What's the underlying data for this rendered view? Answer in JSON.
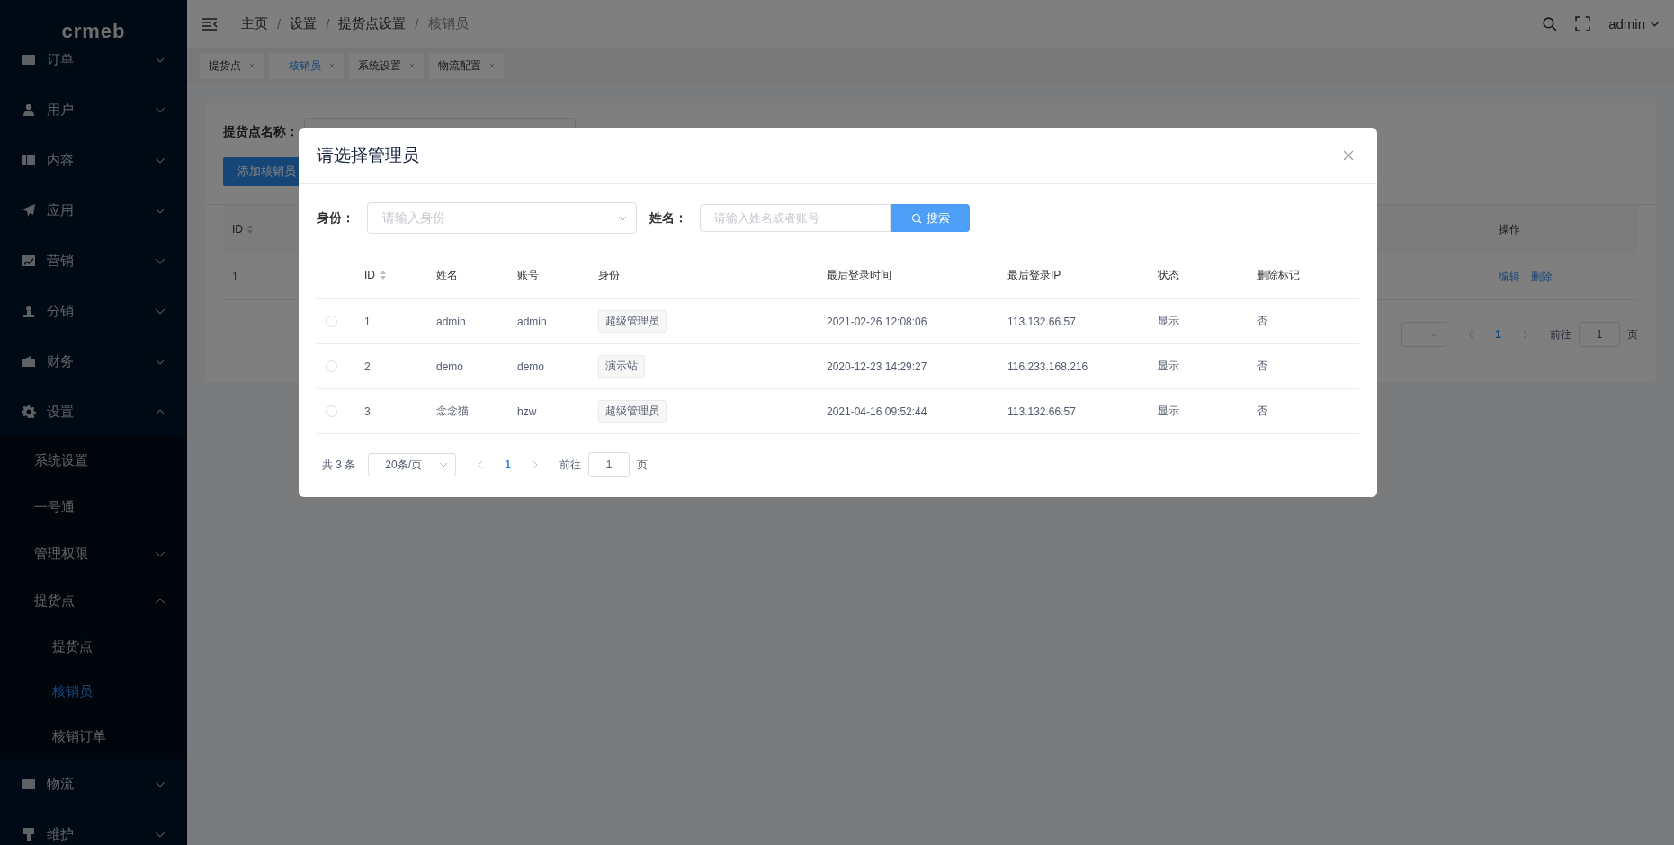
{
  "sidebar": {
    "logo": "crmeb",
    "items": [
      {
        "label": "订单",
        "expanded": false
      },
      {
        "label": "用户",
        "expanded": false
      },
      {
        "label": "内容",
        "expanded": false
      },
      {
        "label": "应用",
        "expanded": false
      },
      {
        "label": "营销",
        "expanded": false
      },
      {
        "label": "分销",
        "expanded": false
      },
      {
        "label": "财务",
        "expanded": false
      },
      {
        "label": "设置",
        "expanded": true,
        "children": [
          {
            "label": "系统设置"
          },
          {
            "label": "一号通"
          },
          {
            "label": "管理权限",
            "expanded": false
          },
          {
            "label": "提货点",
            "expanded": true,
            "children": [
              {
                "label": "提货点",
                "selected": false
              },
              {
                "label": "核销员",
                "selected": true
              },
              {
                "label": "核销订单",
                "selected": false
              }
            ]
          }
        ]
      },
      {
        "label": "物流",
        "expanded": false
      },
      {
        "label": "维护",
        "expanded": false
      }
    ]
  },
  "header": {
    "breadcrumb": [
      "主页",
      "设置",
      "提货点设置",
      "核销员"
    ],
    "breadcrumb_separator": "/",
    "user": "admin"
  },
  "tabs": [
    {
      "label": "提货点",
      "selected": false
    },
    {
      "label": "核销员",
      "selected": true
    },
    {
      "label": "系统设置",
      "selected": false
    },
    {
      "label": "物流配置",
      "selected": false
    }
  ],
  "page": {
    "filter_label": "提货点名称：",
    "add_button": "添加核销员",
    "columns": [
      {
        "label": "ID",
        "sortable": true
      },
      {
        "label": "操作",
        "sortable": false
      }
    ],
    "rows": [
      {
        "id": "1",
        "actions": [
          "编辑",
          "删除"
        ]
      }
    ],
    "pagination": {
      "page": "1",
      "jump_label": "前往",
      "jump_value": "1",
      "unit": "页"
    }
  },
  "modal": {
    "title": "请选择管理员",
    "filters": {
      "role_label": "身份：",
      "role_placeholder": "请输入身份",
      "name_label": "姓名：",
      "name_placeholder": "请输入姓名或者账号",
      "search_button": "搜索"
    },
    "columns": [
      {
        "label": "ID",
        "sortable": true
      },
      {
        "label": "姓名",
        "sortable": false
      },
      {
        "label": "账号",
        "sortable": false
      },
      {
        "label": "身份",
        "sortable": false
      },
      {
        "label": "最后登录时间",
        "sortable": false
      },
      {
        "label": "最后登录IP",
        "sortable": false
      },
      {
        "label": "状态",
        "sortable": false
      },
      {
        "label": "删除标记",
        "sortable": false
      }
    ],
    "rows": [
      {
        "selected": false,
        "id": "1",
        "name": "admin",
        "account": "admin",
        "role": "超级管理员",
        "last_login": "2021-02-26 12:08:06",
        "ip": "113.132.66.57",
        "status": "显示",
        "deleted": "否"
      },
      {
        "selected": false,
        "id": "2",
        "name": "demo",
        "account": "demo",
        "role": "演示站",
        "last_login": "2020-12-23 14:29:27",
        "ip": "116.233.168.216",
        "status": "显示",
        "deleted": "否"
      },
      {
        "selected": false,
        "id": "3",
        "name": "念念猫",
        "account": "hzw",
        "role": "超级管理员",
        "last_login": "2021-04-16 09:52:44",
        "ip": "113.132.66.57",
        "status": "显示",
        "deleted": "否"
      }
    ],
    "pagination": {
      "total": "共 3 条",
      "page_size": "20条/页",
      "page": "1",
      "jump_label": "前往",
      "jump_value": "1",
      "unit": "页"
    }
  }
}
